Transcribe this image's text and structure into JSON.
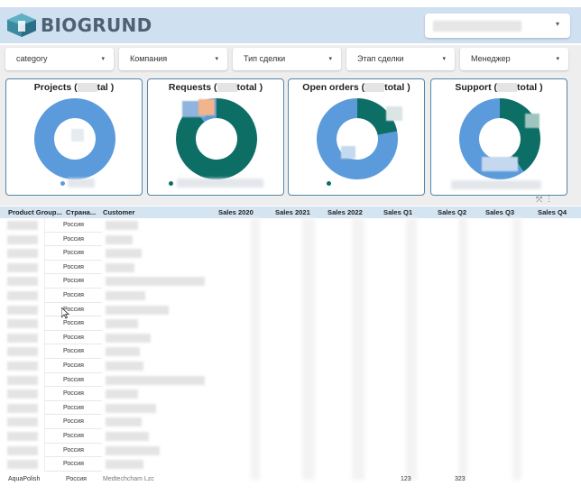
{
  "app": {
    "logo_text": "BIOGRUND",
    "brand_color": "#4e6275",
    "header_bg": "#cfe0f1"
  },
  "filters": [
    {
      "label": "category"
    },
    {
      "label": "Компания"
    },
    {
      "label": "Тип сделки"
    },
    {
      "label": "Этап сделки"
    },
    {
      "label": "Менеджер"
    }
  ],
  "cards": [
    {
      "title_prefix": "Projects (",
      "title_suffix": "tal )",
      "segments": [
        {
          "value": 1.0,
          "color": "#5b9bdc"
        }
      ]
    },
    {
      "title_prefix": "Requests (",
      "title_suffix": "total )",
      "segments": [
        {
          "value": 0.9,
          "color": "#0d6e66"
        },
        {
          "value": 0.1,
          "color": "#5b9bdc"
        }
      ]
    },
    {
      "title_prefix": "Open orders (",
      "title_suffix": "total )",
      "segments": [
        {
          "value": 0.22,
          "color": "#0d6e66"
        },
        {
          "value": 0.78,
          "color": "#5b9bdc"
        }
      ]
    },
    {
      "title_prefix": "Support (",
      "title_suffix": "total )",
      "segments": [
        {
          "value": 0.4,
          "color": "#0d6e66"
        },
        {
          "value": 0.6,
          "color": "#5b9bdc"
        }
      ]
    }
  ],
  "table": {
    "columns": [
      "Product Group...",
      "Страна...",
      "Customer",
      "Sales 2020",
      "Sales 2021",
      "Sales 2022",
      "Sales Q1",
      "Sales Q2",
      "Sales Q3",
      "Sales Q4"
    ],
    "country_value": "Россия",
    "rows": 18,
    "last_row": {
      "product_group": "AquaPolish",
      "country": "Россия",
      "customer": "Medtechcham Lzc",
      "q1": "123",
      "q2": "323"
    }
  }
}
